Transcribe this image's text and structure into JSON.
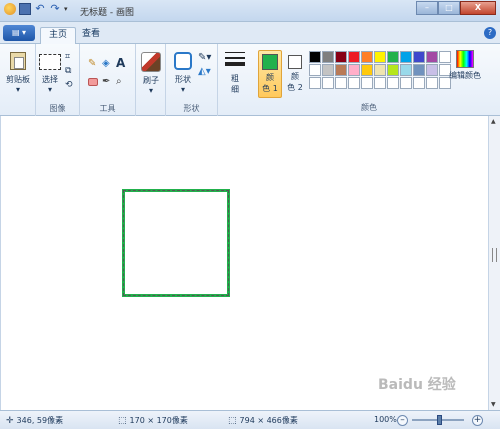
{
  "window": {
    "title": "无标题 - 画图",
    "minimize_label": "–",
    "maximize_label": "□",
    "close_label": "X"
  },
  "tabs": {
    "file_menu": "▤ ▾",
    "home": "主页",
    "view": "查看"
  },
  "ribbon": {
    "clipboard_label": "剪贴板",
    "select_label": "选择",
    "image_group": "图像",
    "tools_group": "工具",
    "brushes_label": "刷子",
    "shapes_label": "形状",
    "shapes_group": "形状",
    "size_label_top": "粗",
    "size_label_bottom": "细",
    "color1_top": "颜",
    "color1_bottom": "色 1",
    "color2_top": "颜",
    "color2_bottom": "色 2",
    "colors_group": "颜色",
    "edit_colors": "编辑颜色",
    "text_tool": "A"
  },
  "palette": [
    "#000000",
    "#7f7f7f",
    "#880015",
    "#ed1c24",
    "#ff7f27",
    "#fff200",
    "#22b14c",
    "#00a2e8",
    "#3f48cc",
    "#a349a4",
    "#ffffff",
    "#ffffff",
    "#c3c3c3",
    "#b97a57",
    "#ffaec9",
    "#ffc90e",
    "#efe4b0",
    "#b5e61d",
    "#99d9ea",
    "#7092be",
    "#c8bfe7",
    "#ffffff",
    "#ffffff",
    "#ffffff",
    "#ffffff",
    "#ffffff",
    "#ffffff",
    "#ffffff",
    "#ffffff",
    "#ffffff",
    "#ffffff",
    "#ffffff",
    "#ffffff"
  ],
  "colors": {
    "color1": "#22b14c",
    "color2": "#ffffff"
  },
  "status": {
    "cursor_pos": "346, 59像素",
    "selection_size": "170 × 170像素",
    "canvas_size": "794 × 466像素",
    "zoom": "100%"
  },
  "watermark": "Baidu 经验"
}
